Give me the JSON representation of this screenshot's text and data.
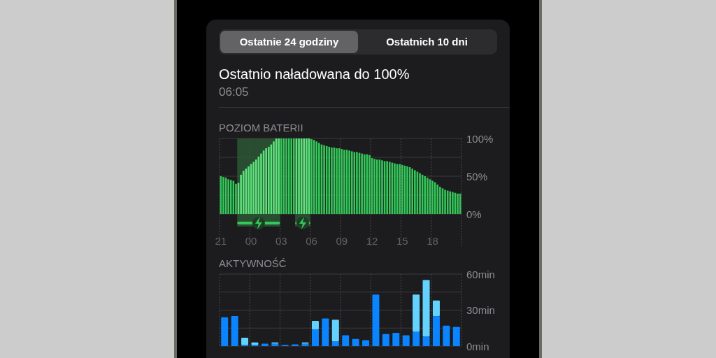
{
  "tabs": [
    {
      "label": "Ostatnie 24 godziny",
      "selected": true
    },
    {
      "label": "Ostatnich 10 dni",
      "selected": false
    }
  ],
  "last_charge": {
    "title": "Ostatnio naładowana do 100%",
    "time": "06:05"
  },
  "battery_level": {
    "title": "POZIOM BATERII",
    "chart_data": {
      "type": "bar",
      "categories": [
        "21",
        null,
        null,
        null,
        null,
        null,
        null,
        null,
        null,
        null,
        null,
        null,
        "00",
        null,
        null,
        null,
        null,
        null,
        null,
        null,
        null,
        null,
        null,
        null,
        "03",
        null,
        null,
        null,
        null,
        null,
        null,
        null,
        null,
        null,
        null,
        null,
        "06",
        null,
        null,
        null,
        null,
        null,
        null,
        null,
        null,
        null,
        null,
        null,
        "09",
        null,
        null,
        null,
        null,
        null,
        null,
        null,
        null,
        null,
        null,
        null,
        "12",
        null,
        null,
        null,
        null,
        null,
        null,
        null,
        null,
        null,
        null,
        null,
        "15",
        null,
        null,
        null,
        null,
        null,
        null,
        null,
        null,
        null,
        null,
        null,
        "18",
        null,
        null,
        null,
        null,
        null,
        null,
        null,
        null,
        null,
        null,
        null
      ],
      "values": [
        50,
        49,
        48,
        46,
        45,
        44,
        40,
        41,
        52,
        57,
        60,
        63,
        66,
        69,
        72,
        76,
        80,
        84,
        87,
        89,
        92,
        96,
        100,
        100,
        100,
        100,
        100,
        100,
        100,
        100,
        100,
        100,
        100,
        100,
        100,
        100,
        99,
        98,
        96,
        94,
        92,
        91,
        90,
        89,
        88,
        88,
        87,
        87,
        86,
        85,
        85,
        84,
        83,
        82,
        82,
        81,
        80,
        79,
        79,
        78,
        74,
        73,
        72,
        72,
        71,
        70,
        70,
        69,
        68,
        67,
        66,
        66,
        65,
        64,
        63,
        62,
        60,
        58,
        56,
        54,
        52,
        50,
        48,
        46,
        44,
        42,
        39,
        36,
        34,
        32,
        31,
        30,
        29,
        28,
        27,
        27
      ],
      "ylim": [
        0,
        100
      ],
      "yticks": [
        {
          "value": 0,
          "label": "0%"
        },
        {
          "value": 50,
          "label": "50%"
        },
        {
          "value": 100,
          "label": "100%"
        }
      ]
    },
    "charging": [
      false,
      false,
      false,
      false,
      false,
      false,
      false,
      true,
      true,
      true,
      true,
      true,
      true,
      true,
      true,
      true,
      true,
      true,
      true,
      true,
      true,
      true,
      true,
      true,
      false,
      false,
      false,
      false,
      false,
      false,
      true,
      true,
      true,
      true,
      true,
      true,
      false,
      false,
      false,
      false,
      false,
      false,
      false,
      false,
      false,
      false,
      false,
      false,
      false,
      false,
      false,
      false,
      false,
      false,
      false,
      false,
      false,
      false,
      false,
      false,
      false,
      false,
      false,
      false,
      false,
      false,
      false,
      false,
      false,
      false,
      false,
      false,
      false,
      false,
      false,
      false,
      false,
      false,
      false,
      false,
      false,
      false,
      false,
      false,
      false,
      false,
      false,
      false,
      false,
      false,
      false,
      false,
      false,
      false,
      false,
      false
    ]
  },
  "activity": {
    "title": "AKTYWNOŚĆ",
    "chart_data": {
      "type": "bar",
      "stacked": true,
      "series": [
        {
          "color": "#0a84ff",
          "values": [
            24,
            25,
            1,
            1,
            2,
            2,
            1,
            1.5,
            2,
            14,
            23,
            4,
            9,
            6,
            5,
            43,
            10,
            11,
            9,
            12,
            8,
            25,
            17,
            16
          ]
        },
        {
          "color": "#64d2ff",
          "values": [
            0,
            0,
            6,
            2,
            0,
            1,
            0,
            0,
            1,
            7,
            0,
            18,
            0,
            0,
            0,
            0,
            0,
            0,
            0,
            31,
            47,
            13,
            0,
            0
          ]
        }
      ],
      "ylim": [
        0,
        60
      ],
      "yticks": [
        {
          "value": 0,
          "label": "0min"
        },
        {
          "value": 30,
          "label": "30min"
        },
        {
          "value": 60,
          "label": "60min"
        }
      ]
    }
  }
}
